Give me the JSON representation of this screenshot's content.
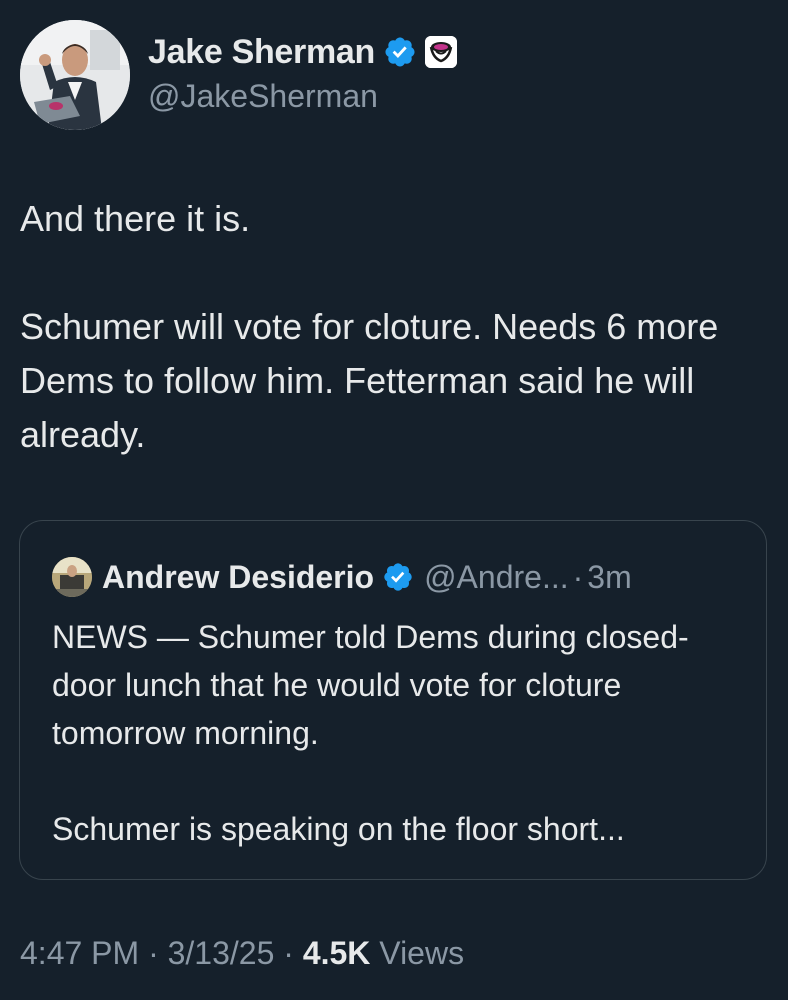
{
  "author": {
    "name": "Jake Sherman",
    "handle": "@JakeSherman"
  },
  "tweet": {
    "paragraphs": [
      "And there it is.",
      "Schumer will vote for cloture. Needs 6 more Dems to follow him. Fetterman said he will already."
    ]
  },
  "quoted_tweet": {
    "name": "Andrew Desiderio",
    "handle": "@Andre...",
    "separator": "·",
    "time": "3m",
    "paragraphs": [
      "NEWS — Schumer told Dems during closed-door lunch that he would vote for cloture tomorrow morning.",
      "Schumer is speaking on the floor short..."
    ]
  },
  "meta": {
    "time": "4:47 PM",
    "date": "3/13/25",
    "views_count": "4.5K",
    "views_label": "Views",
    "separator": "·"
  },
  "icons": {
    "verified": "verified-badge-icon",
    "affiliate": "affiliate-badge-icon"
  },
  "colors": {
    "background": "#15202b",
    "text": "#e7e9ea",
    "secondary": "#8b98a5",
    "verified": "#1d9bf0",
    "border": "#38444d"
  }
}
